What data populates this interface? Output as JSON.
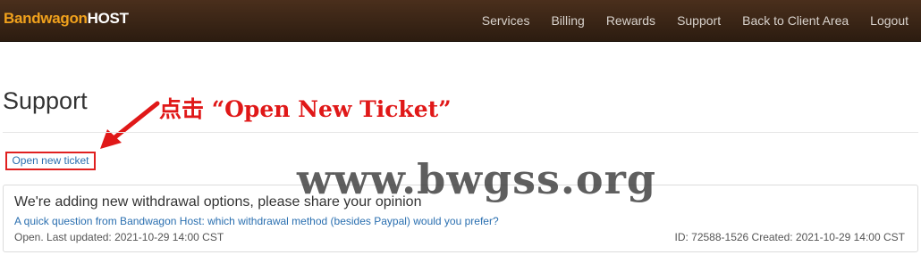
{
  "brand": {
    "part1": "Bandwagon",
    "part2": "HOST"
  },
  "nav": [
    "Services",
    "Billing",
    "Rewards",
    "Support",
    "Back to Client Area",
    "Logout"
  ],
  "page": {
    "title": "Support"
  },
  "annotation": {
    "text": "点击 “Open New Ticket”"
  },
  "actions": {
    "open_new_ticket": "Open new ticket"
  },
  "ticket": {
    "title": "We're adding new withdrawal options, please share your opinion",
    "question": "A quick question from Bandwagon Host: which withdrawal method (besides Paypal) would you prefer?",
    "status": "Open. Last updated: 2021-10-29 14:00 CST",
    "meta": "ID: 72588-1526 Created: 2021-10-29 14:00 CST"
  },
  "watermark": "www.bwgss.org",
  "colors": {
    "annotation_red": "#e01818",
    "link_blue": "#2a6fb0",
    "brand_orange": "#f0a11c"
  }
}
